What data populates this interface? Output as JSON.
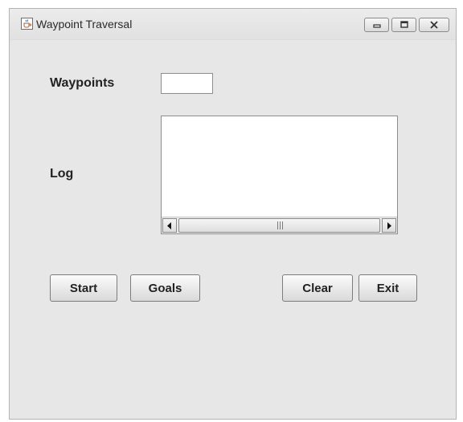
{
  "window": {
    "title": "Waypoint Traversal",
    "app_icon": "java-cup-icon",
    "controls": {
      "minimize": "minimize-icon",
      "maximize": "maximize-icon",
      "close": "close-icon"
    }
  },
  "form": {
    "waypoints_label": "Waypoints",
    "waypoints_value": "",
    "waypoints_placeholder": "",
    "log_label": "Log",
    "log_content": ""
  },
  "buttons": {
    "start": "Start",
    "goals": "Goals",
    "clear": "Clear",
    "exit": "Exit"
  }
}
